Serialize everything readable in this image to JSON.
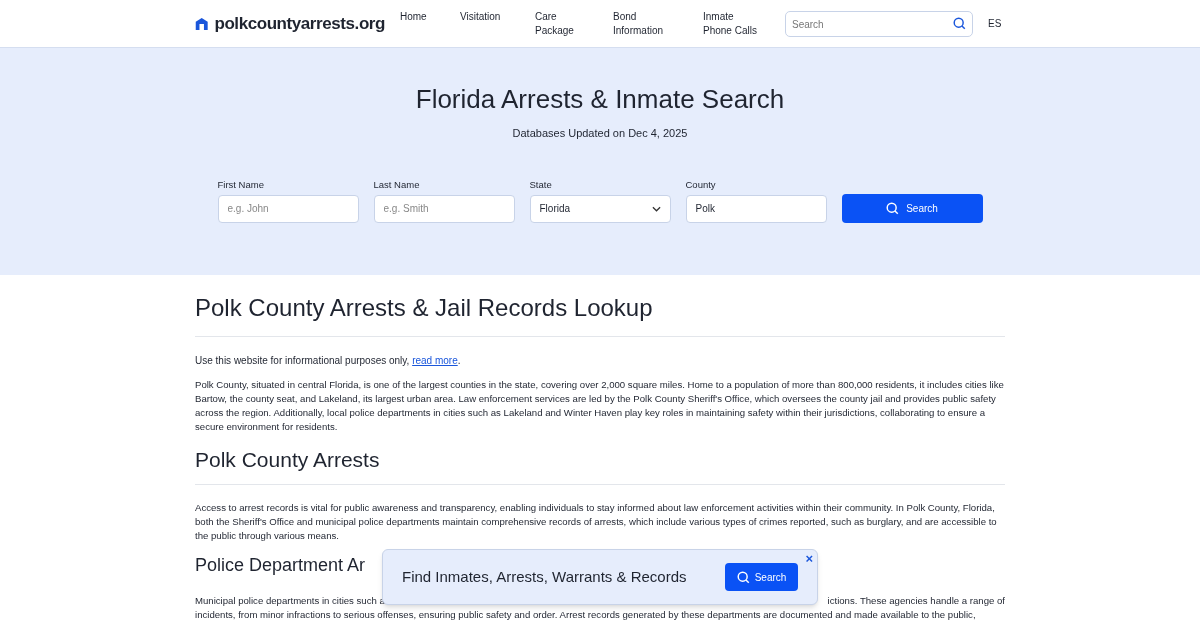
{
  "header": {
    "logo": "polkcountyarrests.org",
    "nav": [
      {
        "label": "Home"
      },
      {
        "label": "Visitation"
      },
      {
        "label": "Care Package"
      },
      {
        "label": "Bond Information"
      },
      {
        "label": "Inmate Phone Calls"
      }
    ],
    "search": {
      "placeholder": "Search"
    },
    "language": "ES"
  },
  "hero": {
    "title": "Florida Arrests & Inmate Search",
    "subtitle": "Databases Updated on Dec 4, 2025",
    "fields": [
      {
        "kind": "text",
        "label": "First Name",
        "placeholder": "e.g. John"
      },
      {
        "kind": "text",
        "label": "Last Name",
        "placeholder": "e.g. Smith"
      },
      {
        "kind": "select",
        "label": "State",
        "value": "Florida"
      },
      {
        "kind": "text",
        "label": "County",
        "value": "Polk"
      }
    ],
    "button": "Search"
  },
  "content": {
    "title": "Polk County Arrests & Jail Records Lookup",
    "notice": "Use this website for informational purposes only,",
    "notice_link": "read more",
    "notice_end": ".",
    "intro": "Polk County, situated in central Florida, is one of the largest counties in the state, covering over 2,000 square miles. Home to a population of more than 800,000 residents, it includes cities like Bartow, the county seat, and Lakeland, its largest urban area. Law enforcement services are led by the Polk County Sheriff's Office, which oversees the county jail and provides public safety across the region. Additionally, local police departments in cities such as Lakeland and Winter Haven play key roles in maintaining safety within their jurisdictions, collaborating to ensure a secure environment for residents.",
    "sections": [
      {
        "heading": "Polk County Arrests",
        "text": "Access to arrest records is vital for public awareness and transparency, enabling individuals to stay informed about law enforcement activities within their community. In Polk County, Florida, both the Sheriff's Office and municipal police departments maintain comprehensive records of arrests, which include various types of crimes reported, such as burglary, and are accessible to the public through various means."
      },
      {
        "heading": "Police Department Ar",
        "line_start": "Municipal police departments in cities such a",
        "line_end": "ictions. These agencies handle a range of",
        "text": "incidents, from minor infractions to serious offenses, ensuring public safety and order. Arrest records generated by these departments are documented and made available to the public,"
      }
    ]
  },
  "popup": {
    "title": "Find Inmates, Arrests, Warrants & Records",
    "button": "Search",
    "close": "×"
  }
}
